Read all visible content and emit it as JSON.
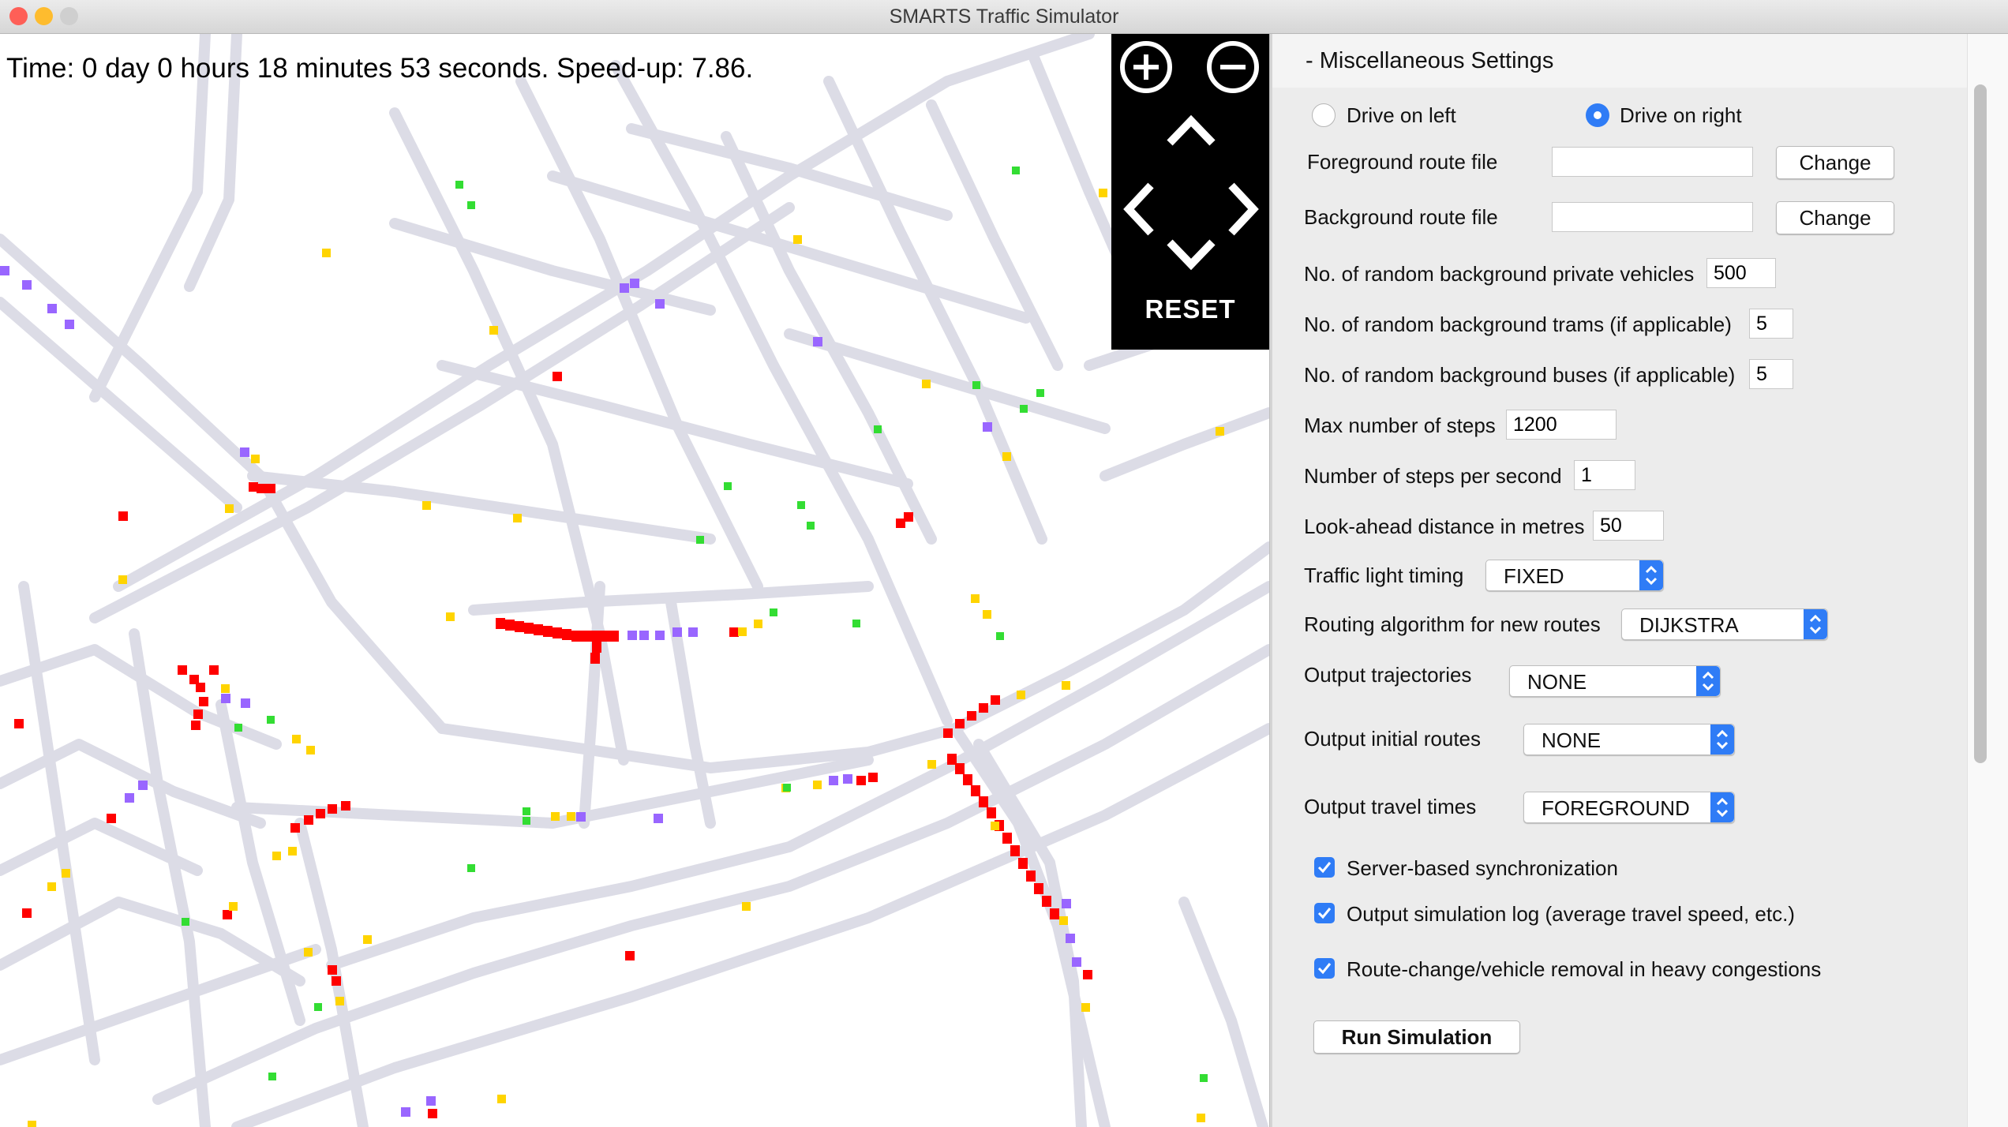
{
  "window": {
    "title": "SMARTS Traffic Simulator"
  },
  "map": {
    "status_text": "Time: 0 day 0 hours 18 minutes 53 seconds. Speed-up: 7.86.",
    "reset_label": "RESET"
  },
  "settings": {
    "section_title": "- Miscellaneous Settings",
    "drive_left_label": "Drive on left",
    "drive_right_label": "Drive on right",
    "drive_selected": "right",
    "foreground_route_label": "Foreground route file",
    "foreground_route_value": "",
    "background_route_label": "Background route file",
    "background_route_value": "",
    "change_label": "Change",
    "private_vehicles_label": "No. of random background private vehicles",
    "private_vehicles_value": "500",
    "trams_label": "No. of random background trams (if applicable)",
    "trams_value": "5",
    "buses_label": "No. of random background buses (if applicable)",
    "buses_value": "5",
    "max_steps_label": "Max number of steps",
    "max_steps_value": "1200",
    "steps_per_second_label": "Number of steps per second",
    "steps_per_second_value": "1",
    "look_ahead_label": "Look-ahead distance in metres",
    "look_ahead_value": "50",
    "traffic_light_label": "Traffic light timing",
    "traffic_light_value": "FIXED",
    "routing_label": "Routing algorithm for new routes",
    "routing_value": "DIJKSTRA",
    "trajectories_label": "Output trajectories",
    "trajectories_value": "NONE",
    "initial_routes_label": "Output initial routes",
    "initial_routes_value": "NONE",
    "travel_times_label": "Output travel times",
    "travel_times_value": "FOREGROUND",
    "server_sync_label": "Server-based synchronization",
    "server_sync_checked": true,
    "sim_log_label": "Output simulation log (average travel speed, etc.)",
    "sim_log_checked": true,
    "route_change_label": "Route-change/vehicle removal in heavy congestions",
    "route_change_checked": true,
    "run_label": "Run Simulation"
  },
  "colors": {
    "road": "#dcdce6",
    "congested": "#ff0000",
    "slow": "#ffd400",
    "moving": "#33dd33",
    "tram": "#9966ff",
    "accent": "#2f7cf6"
  }
}
